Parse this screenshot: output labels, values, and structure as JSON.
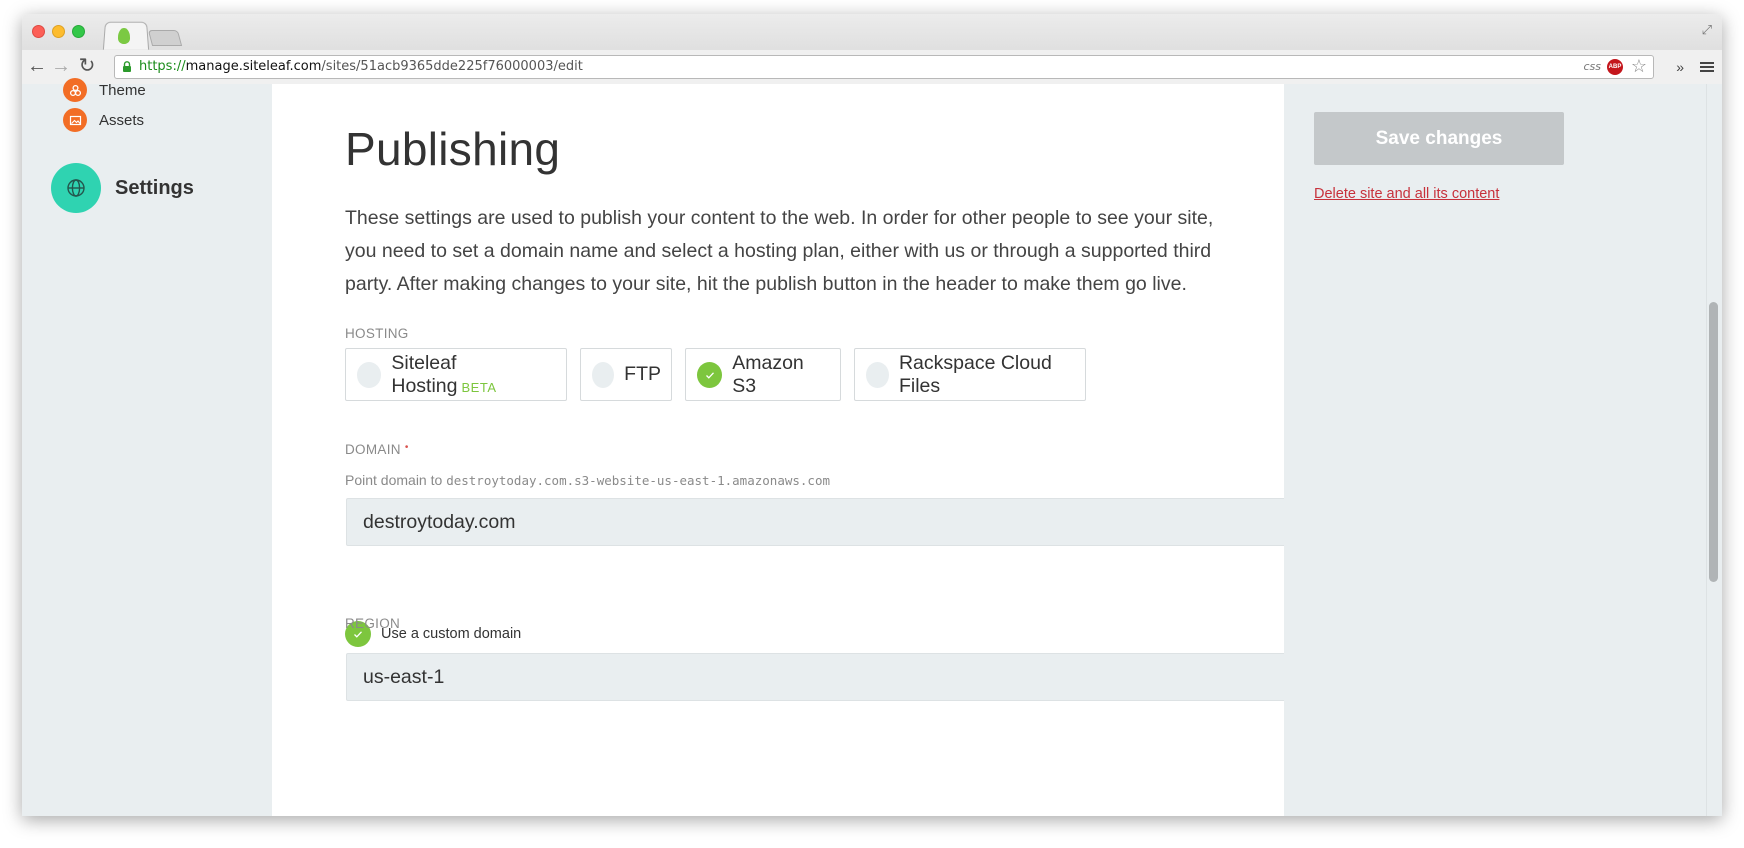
{
  "browser": {
    "url_scheme": "https://",
    "url_host": "manage.siteleaf.com",
    "url_path": "/sites/51acb9365dde225f76000003/edit",
    "css_label": "css",
    "abp_label": "ABP",
    "expand_glyph": "⤢",
    "back_glyph": "←",
    "forward_glyph": "→",
    "reload_glyph": "↻",
    "more_glyph": "»",
    "star_glyph": "☆",
    "traffic_colors": [
      "#fc5f57",
      "#fdbc2e",
      "#33c748"
    ]
  },
  "sidebar": {
    "items": [
      {
        "label": "Theme",
        "icon": "theme-icon"
      },
      {
        "label": "Assets",
        "icon": "image-icon"
      }
    ],
    "active": {
      "label": "Settings",
      "icon": "globe-icon"
    }
  },
  "page": {
    "title": "Publishing",
    "intro": "These settings are used to publish your content to the web. In order for other people to see your site, you need to set a domain name and select a hosting plan, either with us or through a supported third party. After making changes to your site, hit the publish button in the header to make them go live."
  },
  "hosting": {
    "label": "HOSTING",
    "options": [
      {
        "label": "Siteleaf Hosting",
        "badge": "BETA",
        "selected": false
      },
      {
        "label": "FTP",
        "selected": false
      },
      {
        "label": "Amazon S3",
        "selected": true
      },
      {
        "label": "Rackspace Cloud Files",
        "selected": false
      }
    ]
  },
  "domain": {
    "label": "DOMAIN",
    "required_mark": "•",
    "hint_prefix": "Point domain to",
    "hint_target": "destroytoday.com.s3-website-us-east-1.amazonaws.com",
    "value": "destroytoday.com",
    "custom_label": "Use a custom domain",
    "custom_checked": true
  },
  "region": {
    "label": "REGION",
    "value": "us-east-1"
  },
  "actions": {
    "save_label": "Save changes",
    "delete_label": "Delete site and all its content"
  },
  "colors": {
    "accent_green": "#7dc63e",
    "settings_teal": "#2fd3b1",
    "nav_orange": "#f26d25",
    "danger_red": "#c7313b",
    "panel_gray": "#e9eef0"
  }
}
